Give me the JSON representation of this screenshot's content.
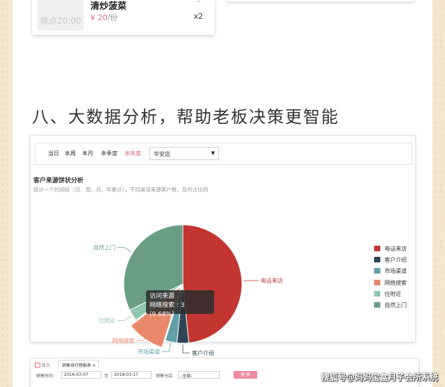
{
  "order": {
    "time_label": "晚点20:00",
    "dish_name": "清炒菠菜",
    "price": "¥ 20",
    "price_unit": "/份",
    "quantity": "x2"
  },
  "section_title": "八、大数据分析，帮助老板决策更智能",
  "filter": {
    "tabs": [
      "当日",
      "本周",
      "本月",
      "本季度",
      "本年度"
    ],
    "active_tab": "本年度",
    "store": "华安店"
  },
  "chart_data": {
    "type": "pie",
    "title": "客户来源饼状分析",
    "subtitle": "统计一个时间段（日、周、月、年累计），不同渠道来源客户数，及所占比例",
    "slices": [
      {
        "name": "电话来访",
        "value": 15,
        "color": "#c23531"
      },
      {
        "name": "客户介绍",
        "value": 1,
        "color": "#2f4554"
      },
      {
        "name": "市场渠道",
        "value": 1,
        "color": "#61a0a8"
      },
      {
        "name": "网络搜索",
        "value": 3,
        "color": "#e9896c"
      },
      {
        "name": "住附近",
        "value": 1,
        "color": "#91c7ae"
      },
      {
        "name": "自然上门",
        "value": 10,
        "color": "#6a9e84"
      }
    ],
    "legend_position": "right",
    "tooltip": {
      "title": "访问来源",
      "text": "网络搜索 : 3 (9.68%)"
    }
  },
  "bottom": {
    "home_label": "首页",
    "tab_label": "销售排行榜报表 ×",
    "time_label": "销售时间:",
    "date_from": "2016-03-07",
    "to_label": "至",
    "date_to": "2018-03-17",
    "store_label": "销售分店:",
    "store_value": "-全部-",
    "search_label": "搜 索"
  },
  "watermark": "搜狐号@妈妈宝盒月子会所系统"
}
